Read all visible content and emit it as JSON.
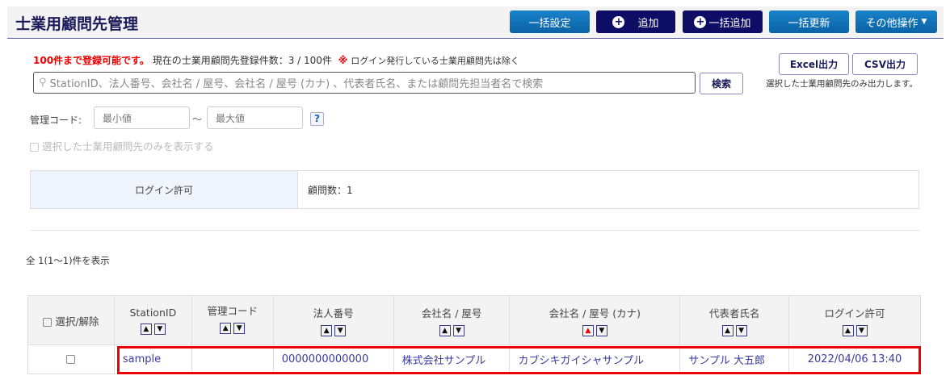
{
  "header": {
    "title": "士業用顧問先管理",
    "buttons": [
      "一括設定",
      "追加",
      "一括追加",
      "一括更新",
      "その他操作"
    ]
  },
  "notice": {
    "limit": "100件まで登録可能です。",
    "count": "現在の士業用顧問先登録件数：3 / 100件",
    "mark": "※",
    "note": "ログイン発行している士業用顧問先は除く"
  },
  "search": {
    "placeholder": "StationID、法人番号、会社名 / 屋号、会社名 / 屋号 (カナ) 、代表者氏名、または顧問先担当者名で検索",
    "button": "検索"
  },
  "export": {
    "excel": "Excel出力",
    "csv": "CSV出力",
    "note": "選択した士業用顧問先のみ出力します。"
  },
  "filter": {
    "label": "管理コード:",
    "min": "最小値",
    "tilde": "～",
    "max": "最大値",
    "help": "?",
    "only_selected": "選択した士業用顧問先のみを表示する"
  },
  "summary": {
    "label": "ログイン許可",
    "value": "顧問数：1"
  },
  "result_count": "全 1(1～1)件を表示",
  "table": {
    "select_all": "選択/解除",
    "columns": [
      "StationID",
      "管理コード",
      "法人番号",
      "会社名 / 屋号",
      "会社名 / 屋号 (カナ)",
      "代表者氏名",
      "ログイン許可"
    ],
    "rows": [
      [
        "sample",
        "",
        "0000000000000",
        "株式会社サンプル",
        "カブシキガイシャサンプル",
        "サンプル 大五郎",
        "2022/04/06 13:40"
      ]
    ]
  },
  "colors": {
    "accent": "#0a62a6",
    "navy": "#0d0d66",
    "highlight": "#ee0000",
    "active_sort": "#ee0000"
  }
}
